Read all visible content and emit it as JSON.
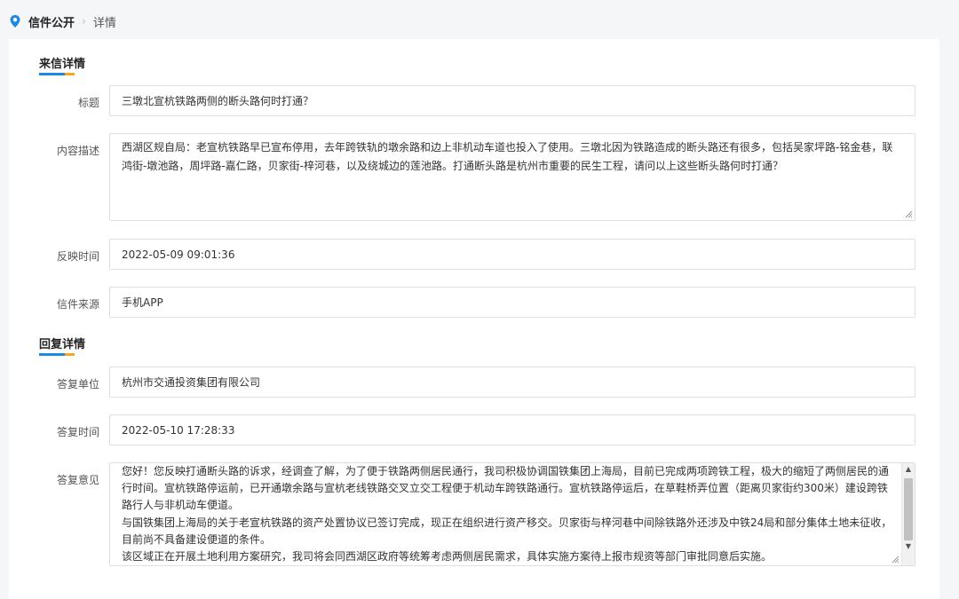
{
  "breadcrumb": {
    "root": "信件公开",
    "separator": "›",
    "current": "详情",
    "icon": "map-pin-icon",
    "icon_color": "#1e88e5"
  },
  "letter": {
    "section_title": "来信详情",
    "title_label": "标题",
    "title_value": "三墩北宣杭铁路两侧的断头路何时打通？",
    "content_label": "内容描述",
    "content_value": "西湖区规自局：老宣杭铁路早已宣布停用，去年跨铁轨的墩余路和边上非机动车道也投入了使用。三墩北因为铁路造成的断头路还有很多，包括吴家坪路-铭金巷，联鸿街-墩池路，周坪路-嘉仁路，贝家街-梓河巷，以及绕城边的莲池路。打通断头路是杭州市重要的民生工程，请问以上这些断头路何时打通？",
    "time_label": "反映时间",
    "time_value": "2022-05-09 09:01:36",
    "source_label": "信件来源",
    "source_value": "手机APP"
  },
  "reply": {
    "section_title": "回复详情",
    "unit_label": "答复单位",
    "unit_value": "杭州市交通投资集团有限公司",
    "time_label": "答复时间",
    "time_value": "2022-05-10 17:28:33",
    "opinion_label": "答复意见",
    "opinion_paragraphs": [
      "您好！您反映打通断头路的诉求，经调查了解，为了便于铁路两侧居民通行，我司积极协调国铁集团上海局，目前已完成两项跨铁工程，极大的缩短了两侧居民的通行时间。宣杭铁路停运前，已开通墩余路与宣杭老线铁路交叉立交工程便于机动车跨铁路通行。宣杭铁路停运后，在草鞋桥弄位置（距离贝家街约300米）建设跨铁路行人与非机动车便道。",
      "与国铁集团上海局的关于老宣杭铁路的资产处置协议已签订完成，现正在组织进行资产移交。贝家街与梓河巷中间除铁路外还涉及中铁24局和部分集体土地未征收，目前尚不具备建设便道的条件。",
      "该区域正在开展土地利用方案研究，我司将会同西湖区政府等统筹考虑两侧居民需求，具体实施方案待上报市规资等部门审批同意后实施。"
    ]
  },
  "colors": {
    "accent_blue": "#1e88e5",
    "accent_orange": "#f5a623"
  }
}
